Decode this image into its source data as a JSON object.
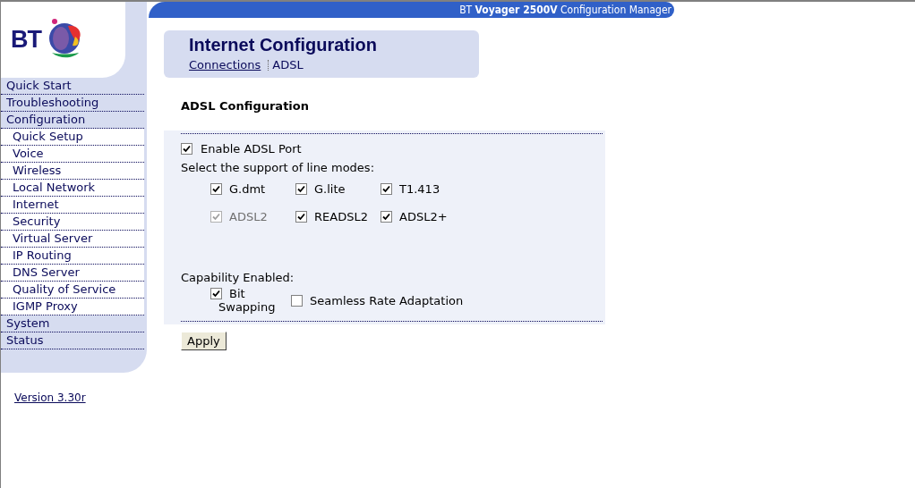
{
  "banner": "BT **Voyager 2500V** Configuration Manager",
  "logo": {
    "text": "BT"
  },
  "sidebar": {
    "items": [
      {
        "label": "Quick Start",
        "selected": false
      },
      {
        "label": "Troubleshooting",
        "selected": false
      },
      {
        "label": "Configuration",
        "selected": false,
        "children": [
          {
            "label": "Quick Setup",
            "selected": false
          },
          {
            "label": "Voice",
            "selected": false
          },
          {
            "label": "Wireless",
            "selected": false
          },
          {
            "label": "Local Network",
            "selected": false
          },
          {
            "label": "Internet",
            "selected": false
          },
          {
            "label": "Security",
            "selected": false
          },
          {
            "label": "Virtual Server",
            "selected": false
          },
          {
            "label": "IP Routing",
            "selected": false
          },
          {
            "label": "DNS Server",
            "selected": false
          },
          {
            "label": "Quality of Service",
            "selected": false
          },
          {
            "label": "IGMP Proxy",
            "selected": false
          }
        ]
      },
      {
        "label": "System",
        "selected": false
      },
      {
        "label": "Status",
        "selected": false
      }
    ],
    "version": "Version 3.30r"
  },
  "page_header": {
    "title": "Internet Configuration",
    "breadcrumb": [
      {
        "label": "Connections",
        "kind": "link"
      },
      {
        "label": "ADSL",
        "kind": "current"
      }
    ]
  },
  "section_title": "ADSL Configuration",
  "enable_port": {
    "label": "Enable ADSL Port",
    "checked": true
  },
  "line_modes": {
    "label": "Select the support of line modes:",
    "options": [
      {
        "label": "G.dmt",
        "checked": true,
        "disabled": false
      },
      {
        "label": "G.lite",
        "checked": true,
        "disabled": false
      },
      {
        "label": "T1.413",
        "checked": true,
        "disabled": false
      },
      {
        "label": "ADSL2",
        "checked": true,
        "disabled": true
      },
      {
        "label": "READSL2",
        "checked": true,
        "disabled": false
      },
      {
        "label": "ADSL2+",
        "checked": true,
        "disabled": false
      }
    ]
  },
  "capability": {
    "label": "Capability Enabled:",
    "options": [
      {
        "label": "Bit Swapping",
        "checked": true
      },
      {
        "label": "Seamless Rate Adaptation",
        "checked": false
      }
    ]
  },
  "buttons": [
    "Apply"
  ]
}
